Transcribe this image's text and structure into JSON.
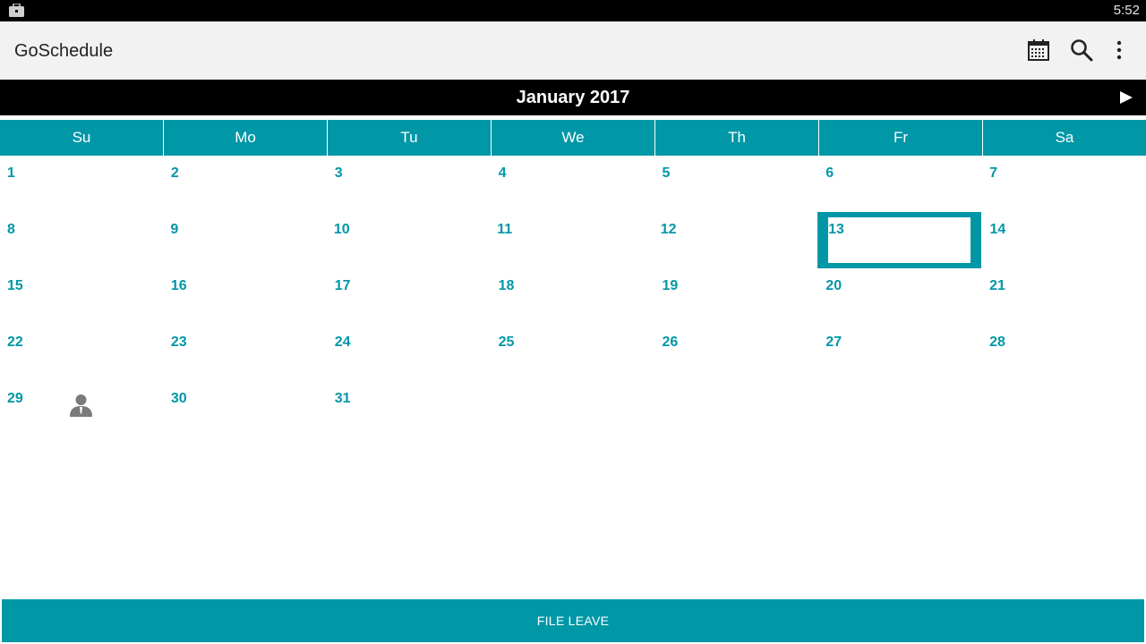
{
  "status_bar": {
    "time": "5:52",
    "notification_icon": "briefcase-icon"
  },
  "app_bar": {
    "title": "GoSchedule",
    "actions": [
      {
        "icon": "calendar-icon"
      },
      {
        "icon": "search-icon"
      },
      {
        "icon": "overflow-menu-icon"
      }
    ]
  },
  "month_nav": {
    "title": "January 2017",
    "next_icon": "play-arrow-icon"
  },
  "weekdays": [
    "Su",
    "Mo",
    "Tu",
    "We",
    "Th",
    "Fr",
    "Sa"
  ],
  "weeks": [
    [
      "1",
      "2",
      "3",
      "4",
      "5",
      "6",
      "7"
    ],
    [
      "8",
      "9",
      "10",
      "11",
      "12",
      "13",
      "14"
    ],
    [
      "15",
      "16",
      "17",
      "18",
      "19",
      "20",
      "21"
    ],
    [
      "22",
      "23",
      "24",
      "25",
      "26",
      "27",
      "28"
    ],
    [
      "29",
      "30",
      "31",
      "",
      "",
      "",
      ""
    ]
  ],
  "selected_day": "13",
  "event_marker_day": "29",
  "event_marker_icon": "person-icon",
  "footer": {
    "file_leave_label": "FILE LEAVE"
  },
  "colors": {
    "accent": "#0097a7",
    "status_bar": "#000000",
    "app_bar": "#f2f2f2",
    "month_bar": "#000000"
  }
}
